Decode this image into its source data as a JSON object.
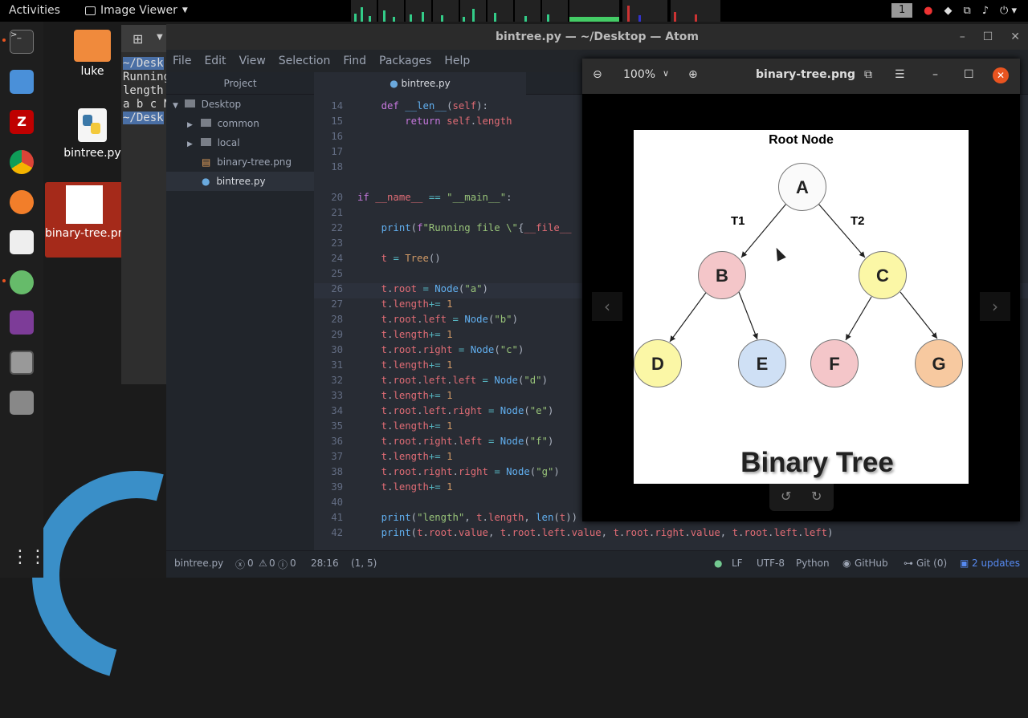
{
  "topbar": {
    "activities": "Activities",
    "app_menu": "Image Viewer",
    "workspace": "1"
  },
  "desktop": {
    "icons": [
      {
        "label": "luke"
      },
      {
        "label": "bintree.py"
      },
      {
        "label": "binary-tree.png"
      }
    ]
  },
  "terminal": {
    "lines": [
      "~/Desk",
      "Running",
      "length",
      "a b c N",
      "~/Desk"
    ]
  },
  "atom": {
    "title": "bintree.py — ~/Desktop — Atom",
    "menu": [
      "File",
      "Edit",
      "View",
      "Selection",
      "Find",
      "Packages",
      "Help"
    ],
    "project": {
      "header": "Project",
      "root": "Desktop",
      "items": [
        "common",
        "local",
        "binary-tree.png",
        "bintree.py"
      ]
    },
    "tab": "bintree.py",
    "status": {
      "file": "bintree.py",
      "diag_errors": "0",
      "diag_warnings": "0",
      "diag_info": "0",
      "cursor": "28:16",
      "selection": "(1, 5)",
      "eol": "LF",
      "encoding": "UTF-8",
      "grammar": "Python",
      "github": "GitHub",
      "git": "Git (0)",
      "updates": "2 updates"
    }
  },
  "viewer": {
    "zoom": "100%",
    "title": "binary-tree.png",
    "image": {
      "root_label": "Root Node",
      "t1": "T1",
      "t2": "T2",
      "caption": "Binary Tree",
      "nodes": [
        "A",
        "B",
        "C",
        "D",
        "E",
        "F",
        "G"
      ]
    }
  },
  "colors": {
    "accent": "#e95420",
    "node_pink": "#f4c6c9",
    "node_yellow": "#fbf7a6",
    "node_blue": "#cfe0f5",
    "node_peach": "#f7c9a0"
  }
}
